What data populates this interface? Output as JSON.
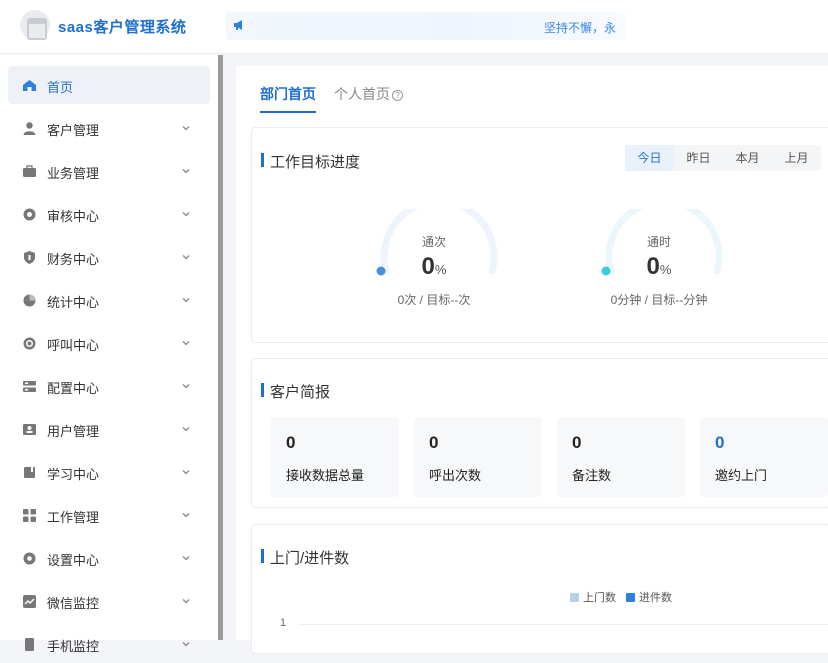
{
  "header": {
    "app_title": "saas客户管理系统",
    "notice_text": "坚持不懈，永",
    "logo_icon": "house-icon",
    "notice_icon": "megaphone-icon"
  },
  "sidebar": {
    "items": [
      {
        "label": "首页",
        "icon": "home-icon",
        "active": true
      },
      {
        "label": "客户管理",
        "icon": "user-icon"
      },
      {
        "label": "业务管理",
        "icon": "briefcase-icon"
      },
      {
        "label": "审核中心",
        "icon": "audit-icon"
      },
      {
        "label": "财务中心",
        "icon": "shield-icon"
      },
      {
        "label": "统计中心",
        "icon": "pie-icon"
      },
      {
        "label": "呼叫中心",
        "icon": "phone-icon"
      },
      {
        "label": "配置中心",
        "icon": "config-icon"
      },
      {
        "label": "用户管理",
        "icon": "id-card-icon"
      },
      {
        "label": "学习中心",
        "icon": "book-icon"
      },
      {
        "label": "工作管理",
        "icon": "grid-icon"
      },
      {
        "label": "设置中心",
        "icon": "gear-icon"
      },
      {
        "label": "微信监控",
        "icon": "chart-icon"
      },
      {
        "label": "手机监控",
        "icon": "mobile-icon"
      }
    ]
  },
  "tabs": [
    {
      "label": "部门首页",
      "active": true
    },
    {
      "label": "个人首页",
      "help": "?"
    }
  ],
  "work_progress": {
    "title": "工作目标进度",
    "periods": [
      "今日",
      "昨日",
      "本月",
      "上月"
    ],
    "active_period": "今日",
    "gauges": [
      {
        "label": "通次",
        "value": "0",
        "unit": "%",
        "sub": "0次 / 目标--次",
        "color": "#4a90e2",
        "progress": 0
      },
      {
        "label": "通时",
        "value": "0",
        "unit": "%",
        "sub": "0分钟 / 目标--分钟",
        "color": "#36cfe0",
        "progress": 0
      }
    ]
  },
  "customer_brief": {
    "title": "客户简报",
    "stats": [
      {
        "value": "0",
        "label": "接收数据总量"
      },
      {
        "value": "0",
        "label": "呼出次数"
      },
      {
        "value": "0",
        "label": "备注数"
      },
      {
        "value": "0",
        "label": "邀约上门"
      }
    ]
  },
  "visits_chart": {
    "title": "上门/进件数",
    "legend": [
      {
        "name": "上门数",
        "color": "#b7d0ee"
      },
      {
        "name": "进件数",
        "color": "#2f7fe0"
      }
    ],
    "y_tick": "1"
  },
  "chart_data": {
    "type": "bar",
    "title": "上门/进件数",
    "series": [
      {
        "name": "上门数",
        "values": []
      },
      {
        "name": "进件数",
        "values": []
      }
    ],
    "categories": [],
    "y_ticks": [
      "1"
    ]
  }
}
